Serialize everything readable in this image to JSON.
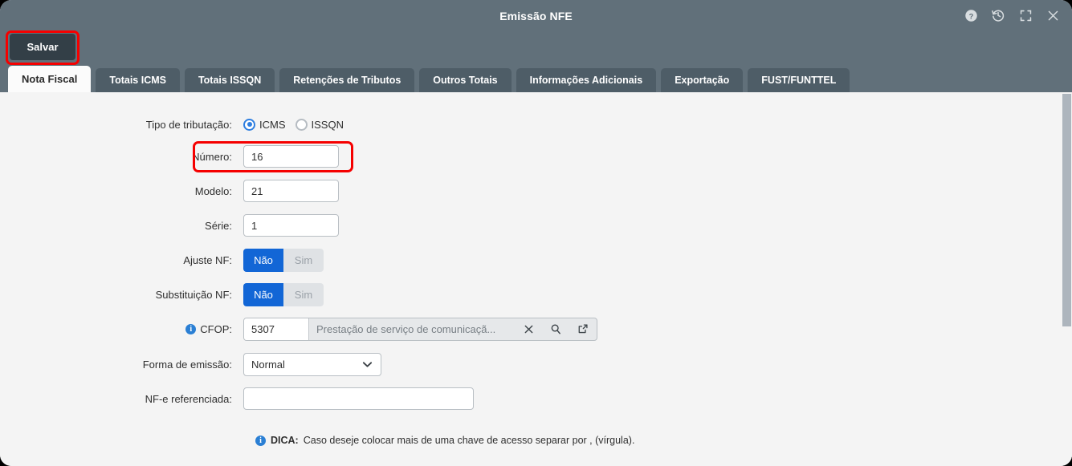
{
  "window": {
    "title": "Emissão NFE",
    "controls": [
      {
        "name": "help-icon",
        "label": "?"
      },
      {
        "name": "history-icon",
        "label": "history"
      },
      {
        "name": "fullscreen-icon",
        "label": "fullscreen"
      },
      {
        "name": "close-icon",
        "label": "close"
      }
    ]
  },
  "toolbar": {
    "save_label": "Salvar"
  },
  "tabs": [
    {
      "label": "Nota Fiscal",
      "active": true
    },
    {
      "label": "Totais ICMS",
      "active": false
    },
    {
      "label": "Totais ISSQN",
      "active": false
    },
    {
      "label": "Retenções de Tributos",
      "active": false
    },
    {
      "label": "Outros Totais",
      "active": false
    },
    {
      "label": "Informações Adicionais",
      "active": false
    },
    {
      "label": "Exportação",
      "active": false
    },
    {
      "label": "FUST/FUNTTEL",
      "active": false
    }
  ],
  "form": {
    "tipo_tributacao": {
      "label": "Tipo de tributação:",
      "options": [
        {
          "label": "ICMS",
          "selected": true
        },
        {
          "label": "ISSQN",
          "selected": false
        }
      ]
    },
    "numero": {
      "label": "Número:",
      "value": "16"
    },
    "modelo": {
      "label": "Modelo:",
      "value": "21"
    },
    "serie": {
      "label": "Série:",
      "value": "1"
    },
    "ajuste_nf": {
      "label": "Ajuste NF:",
      "off_label": "Não",
      "on_label": "Sim",
      "value": "Não"
    },
    "substituicao_nf": {
      "label": "Substituição NF:",
      "off_label": "Não",
      "on_label": "Sim",
      "value": "Não"
    },
    "cfop": {
      "label": "CFOP:",
      "info_glyph": "i",
      "code": "5307",
      "description": "Prestação de serviço de comunicaçã...",
      "clear_glyph": "✕"
    },
    "forma_emissao": {
      "label": "Forma de emissão:",
      "value": "Normal",
      "options": [
        "Normal"
      ]
    },
    "nfe_referenciada": {
      "label": "NF-e referenciada:",
      "value": "",
      "placeholder": ""
    }
  },
  "hint": {
    "icon_glyph": "i",
    "prefix": "DICA:",
    "text": "Caso deseje colocar mais de uma chave de acesso separar por , (vírgula)."
  },
  "colors": {
    "header_bg": "#61707a",
    "tab_bg": "#4e5d67",
    "accent_blue": "#1266d6",
    "annotation_red": "#f50000",
    "content_bg": "#f4f4f4"
  }
}
